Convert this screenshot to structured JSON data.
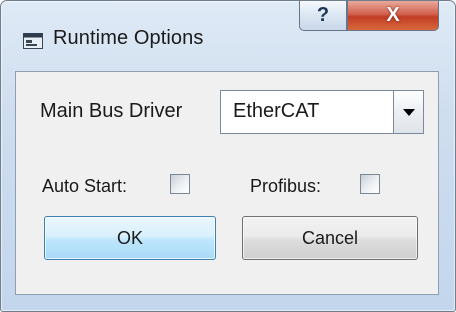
{
  "window": {
    "title": "Runtime Options",
    "icon": "application-window-icon",
    "help_glyph": "?",
    "close_glyph": "X"
  },
  "form": {
    "main_bus_driver_label": "Main Bus Driver",
    "main_bus_driver_value": "EtherCAT",
    "auto_start_label": "Auto Start:",
    "auto_start_checked": false,
    "profibus_label": "Profibus:",
    "profibus_checked": false
  },
  "buttons": {
    "ok_label": "OK",
    "cancel_label": "Cancel"
  },
  "colors": {
    "ok_button_accent": "#bee6fd",
    "close_button": "#c13d26"
  }
}
